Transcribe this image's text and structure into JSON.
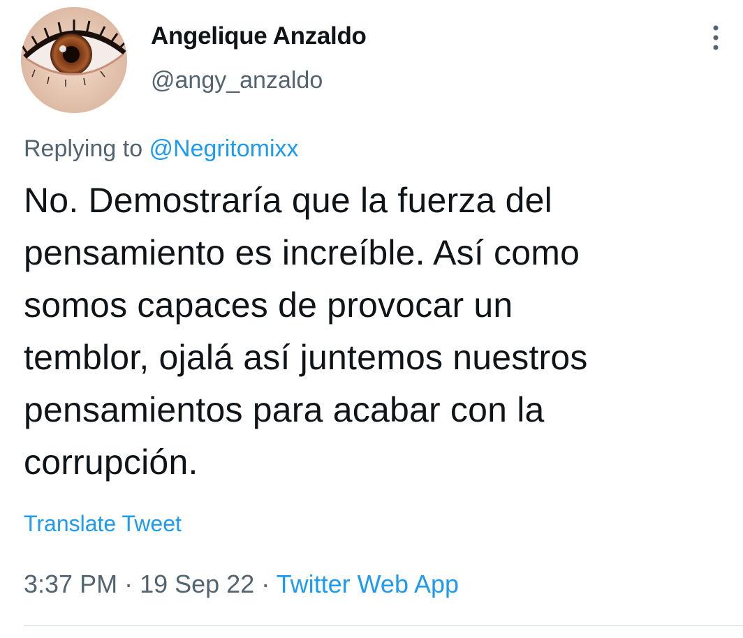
{
  "user": {
    "display_name": "Angelique Anzaldo",
    "handle": "@angy_anzaldo",
    "avatar_icon": "eye-closeup-avatar"
  },
  "more_icon": "more-vertical-icon",
  "reply": {
    "prefix": "Replying to ",
    "mention": "@Negritomixx"
  },
  "tweet": {
    "lines": [
      "No. Demostraría que la fuerza del",
      "pensamiento es increíble. Así como",
      "somos capaces de provocar un",
      "temblor, ojalá así juntemos nuestros",
      "pensamientos para acabar con la",
      "corrupción."
    ]
  },
  "translate_label": "Translate Tweet",
  "meta": {
    "time": "3:37 PM",
    "sep1": " · ",
    "date": "19 Sep 22",
    "sep2": " · ",
    "source": "Twitter Web App"
  },
  "colors": {
    "accent": "#1d9bf0",
    "secondary_text": "#536471",
    "primary_text": "#0f1419",
    "divider": "#cfd9de"
  }
}
